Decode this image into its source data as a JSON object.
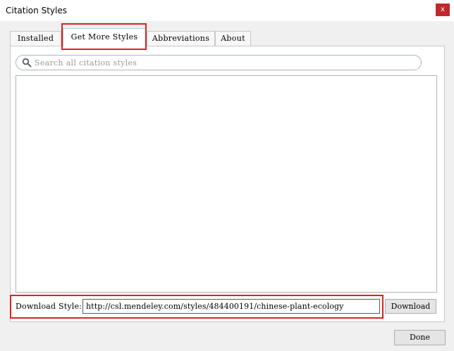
{
  "window": {
    "title": "Citation Styles",
    "close_label": "x"
  },
  "tabs": [
    {
      "label": "Installed",
      "active": false
    },
    {
      "label": "Get More Styles",
      "active": true
    },
    {
      "label": "Abbreviations",
      "active": false
    },
    {
      "label": "About",
      "active": false
    }
  ],
  "search": {
    "placeholder": "Search all citation styles",
    "value": ""
  },
  "download": {
    "label": "Download Style:",
    "url": "http://csl.mendeley.com/styles/484400191/chinese-plant-ecology",
    "button_label": "Download"
  },
  "footer": {
    "done_label": "Done"
  },
  "colors": {
    "highlight": "#e02020",
    "close_button": "#c0282d"
  }
}
